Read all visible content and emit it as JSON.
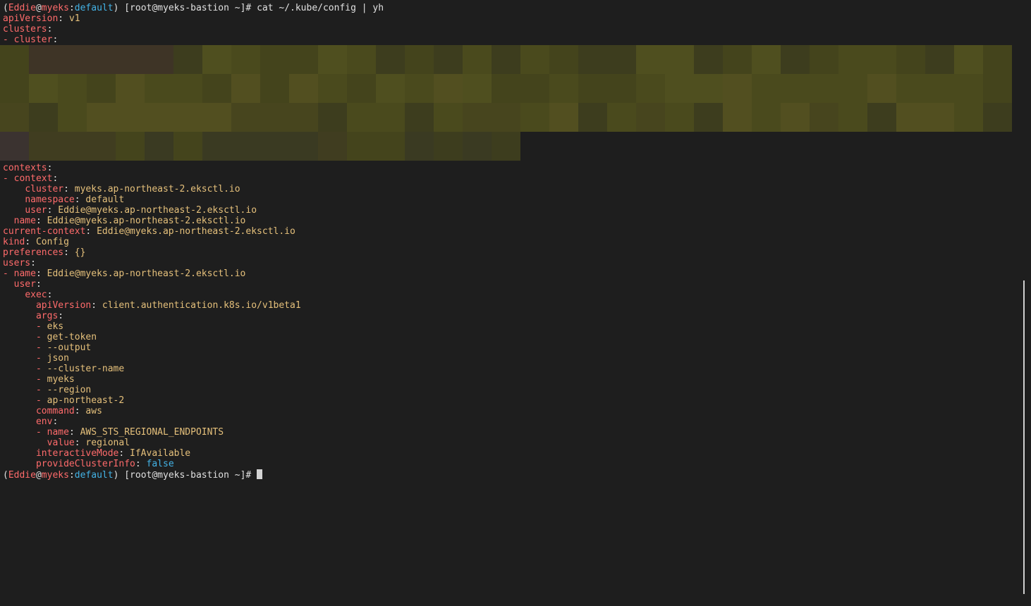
{
  "prompt": {
    "open": "(",
    "user": "Eddie",
    "at": "@",
    "cluster": "myeks",
    "colon": ":",
    "context": "default",
    "close": ")",
    "rest": " [root@myeks-bastion ~]# "
  },
  "command": "cat ~/.kube/config | yh",
  "yaml": {
    "apiVersion_key": "apiVersion",
    "apiVersion_val": "v1",
    "clusters_key": "clusters",
    "cluster_item": "- cluster",
    "contexts_key": "contexts",
    "context_item": "- context",
    "ctx_cluster_key": "cluster",
    "ctx_cluster_val": "myeks.ap-northeast-2.eksctl.io",
    "ctx_namespace_key": "namespace",
    "ctx_namespace_val": "default",
    "ctx_user_key": "user",
    "ctx_user_val": "Eddie@myeks.ap-northeast-2.eksctl.io",
    "ctx_name_key": "name",
    "ctx_name_val": "Eddie@myeks.ap-northeast-2.eksctl.io",
    "current_context_key": "current-context",
    "current_context_val": "Eddie@myeks.ap-northeast-2.eksctl.io",
    "kind_key": "kind",
    "kind_val": "Config",
    "preferences_key": "preferences",
    "preferences_val": "{}",
    "users_key": "users",
    "users_name_key": "- name",
    "users_name_val": "Eddie@myeks.ap-northeast-2.eksctl.io",
    "user_key": "user",
    "exec_key": "exec",
    "exec_apiVersion_key": "apiVersion",
    "exec_apiVersion_val": "client.authentication.k8s.io/v1beta1",
    "args_key": "args",
    "args": [
      "eks",
      "get-token",
      "--output",
      "json",
      "--cluster-name",
      "myeks",
      "--region",
      "ap-northeast-2"
    ],
    "command_key": "command",
    "command_val": "aws",
    "env_key": "env",
    "env_name_key": "- name",
    "env_name_val": "AWS_STS_REGIONAL_ENDPOINTS",
    "env_value_key": "value",
    "env_value_val": "regional",
    "interactiveMode_key": "interactiveMode",
    "interactiveMode_val": "IfAvailable",
    "provideClusterInfo_key": "provideClusterInfo",
    "provideClusterInfo_val": "false"
  },
  "colors": {
    "background": "#1e1e1e",
    "key": "#ff6b6b",
    "string": "#e5c07b",
    "boolean": "#43b3e6",
    "redaction": "#4a4a1e"
  }
}
